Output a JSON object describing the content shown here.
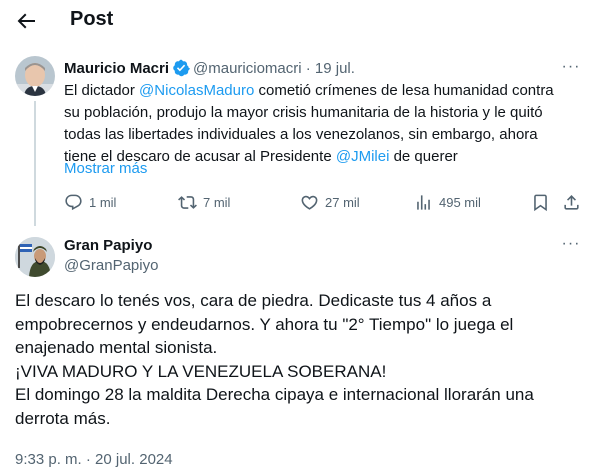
{
  "header": {
    "title": "Post"
  },
  "original_tweet": {
    "author_name": "Mauricio Macri",
    "handle_date": "@mauriciomacri · 19 jul.",
    "text_parts": [
      "El dictador ",
      "@NicolasMaduro",
      " cometió crímenes de lesa humanidad contra su población, produjo la mayor crisis humanitaria de la historia y le quitó todas las libertades individuales a los venezolanos, sin embargo, ahora tiene el descaro de acusar al Presidente ",
      "@JMilei",
      " de querer"
    ],
    "show_more": "Mostrar más",
    "stats": {
      "replies": "1 mil",
      "reposts": "7 mil",
      "likes": "27 mil",
      "views": "495 mil"
    }
  },
  "reply_tweet": {
    "author_name": "Gran Papiyo",
    "handle": "@GranPapiyo",
    "lines": [
      "El descaro lo tenés vos, cara de piedra. Dedicaste tus 4 años a empobrecernos y endeudarnos. Y ahora tu \"2° Tiempo\" lo juega el enajenado mental sionista.",
      "¡VIVA MADURO Y LA VENEZUELA SOBERANA!",
      "El domingo 28 la maldita Derecha cipaya e internacional llorarán una derrota más."
    ],
    "timestamp": "9:33 p. m. · 20 jul. 2024"
  },
  "icons": {
    "back": "arrow-left-icon",
    "verified": "verified-badge-icon",
    "more": "more-horizontal-icon",
    "reply": "reply-icon",
    "repost": "repost-icon",
    "like": "heart-icon",
    "views": "views-chart-icon",
    "bookmark": "bookmark-icon",
    "share": "share-icon"
  },
  "colors": {
    "link": "#1d9bf0",
    "secondary_text": "#536471",
    "verified": "#1d9bf0"
  }
}
